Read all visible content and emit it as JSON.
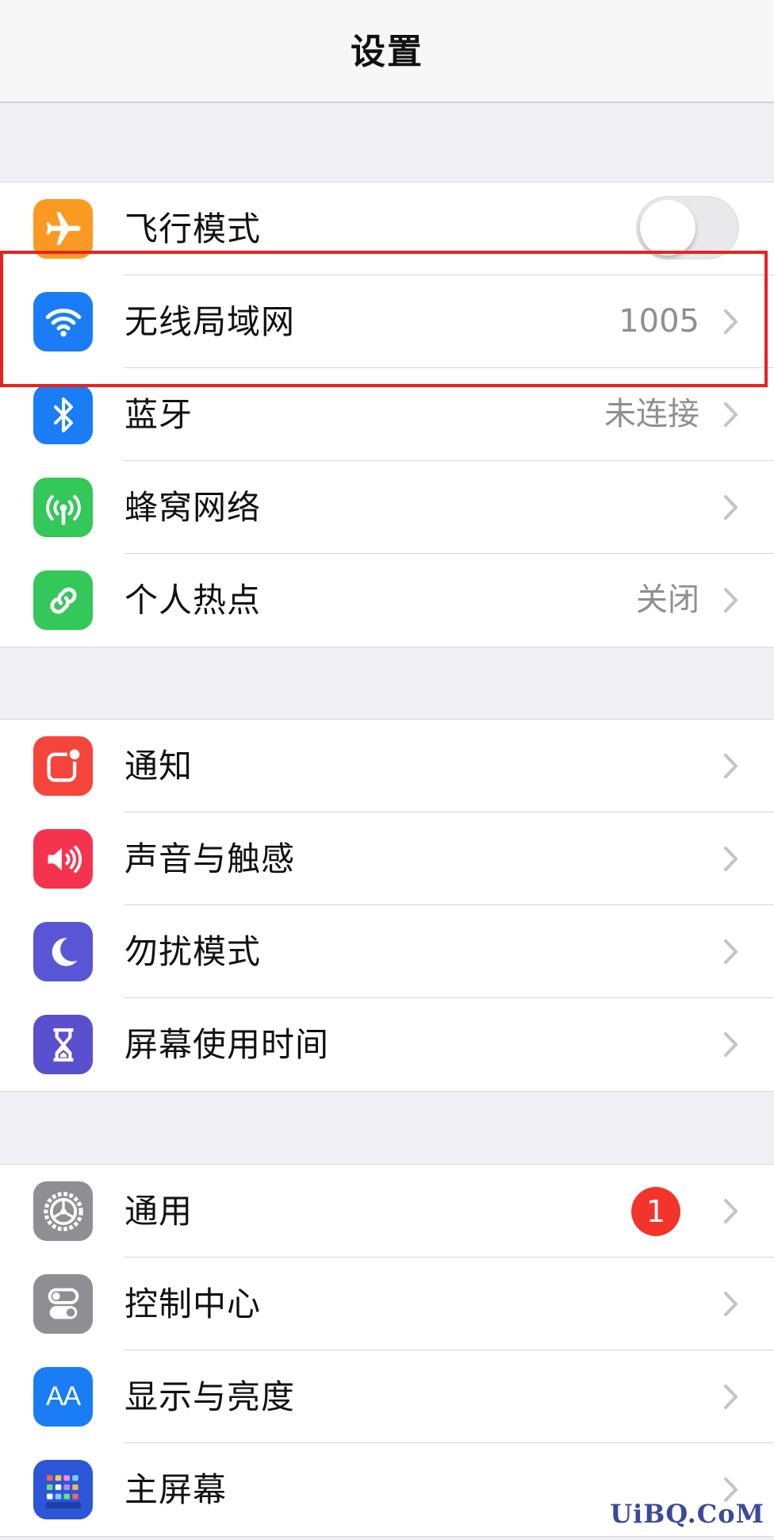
{
  "nav": {
    "title": "设置"
  },
  "group1": {
    "items": [
      {
        "label": "飞行模式",
        "icon": "airplane-icon",
        "color": "#fa9a22",
        "toggle_on": false
      },
      {
        "label": "无线局域网",
        "icon": "wifi-icon",
        "color": "#1a7df5",
        "value": "1005"
      },
      {
        "label": "蓝牙",
        "icon": "bluetooth-icon",
        "color": "#1a7df5",
        "value": "未连接"
      },
      {
        "label": "蜂窝网络",
        "icon": "cellular-antenna-icon",
        "color": "#34c759"
      },
      {
        "label": "个人热点",
        "icon": "hotspot-link-icon",
        "color": "#34c759",
        "value": "关闭"
      }
    ]
  },
  "group2": {
    "items": [
      {
        "label": "通知",
        "icon": "notifications-icon",
        "color": "#f4443b"
      },
      {
        "label": "声音与触感",
        "icon": "speaker-icon",
        "color": "#f4344f"
      },
      {
        "label": "勿扰模式",
        "icon": "moon-icon",
        "color": "#5956d6"
      },
      {
        "label": "屏幕使用时间",
        "icon": "hourglass-icon",
        "color": "#5a4fce"
      }
    ]
  },
  "group3": {
    "items": [
      {
        "label": "通用",
        "icon": "gear-icon",
        "color": "#8e8e93",
        "badge": "1"
      },
      {
        "label": "控制中心",
        "icon": "toggles-icon",
        "color": "#8e8e93"
      },
      {
        "label": "显示与亮度",
        "icon": "text-size-icon",
        "color": "#1a7df5",
        "icon_text": "AA"
      },
      {
        "label": "主屏幕",
        "icon": "home-grid-icon",
        "color": "#2b56d8"
      }
    ]
  },
  "watermark": "UiBQ.CoM",
  "colors": {
    "highlight_border": "#e8231f",
    "badge": "#f3342b",
    "chevron": "#c4c4c7"
  }
}
